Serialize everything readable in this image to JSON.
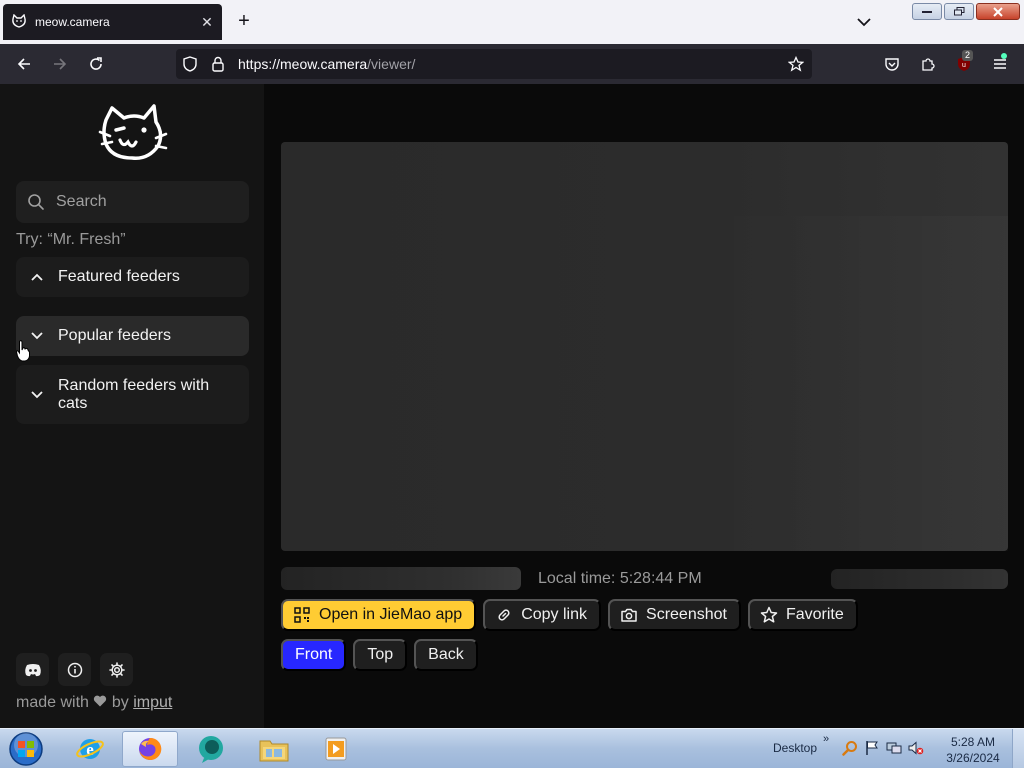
{
  "browser": {
    "tab_title": "meow.camera",
    "url_host": "https://meow.camera",
    "url_path": "/viewer/",
    "extension_badge": "2"
  },
  "sidebar": {
    "search_placeholder": "Search",
    "hint": "Try: “Mr. Fresh”",
    "sections": [
      {
        "label": "Featured feeders",
        "expanded": true
      },
      {
        "label": "Popular feeders",
        "expanded": false
      },
      {
        "label": "Random feeders with cats",
        "expanded": false
      }
    ],
    "footer_prefix": "made with",
    "footer_by": "by",
    "footer_link": "imput"
  },
  "viewer": {
    "local_time": "Local time: 5:28:44 PM",
    "actions": [
      {
        "label": "Open in JieMao app",
        "icon": "qr-code-icon",
        "primary": true
      },
      {
        "label": "Copy link",
        "icon": "link-icon"
      },
      {
        "label": "Screenshot",
        "icon": "camera-icon"
      },
      {
        "label": "Favorite",
        "icon": "star-icon"
      }
    ],
    "views": [
      {
        "label": "Front",
        "active": true
      },
      {
        "label": "Top",
        "active": false
      },
      {
        "label": "Back",
        "active": false
      }
    ]
  },
  "taskbar": {
    "desktop_label": "Desktop",
    "time": "5:28 AM",
    "date": "3/26/2024"
  },
  "colors": {
    "accent_yellow": "#ffcc33",
    "accent_blue": "#2727ff",
    "sidebar_bg": "#141414",
    "page_bg": "#0a0a0a"
  }
}
